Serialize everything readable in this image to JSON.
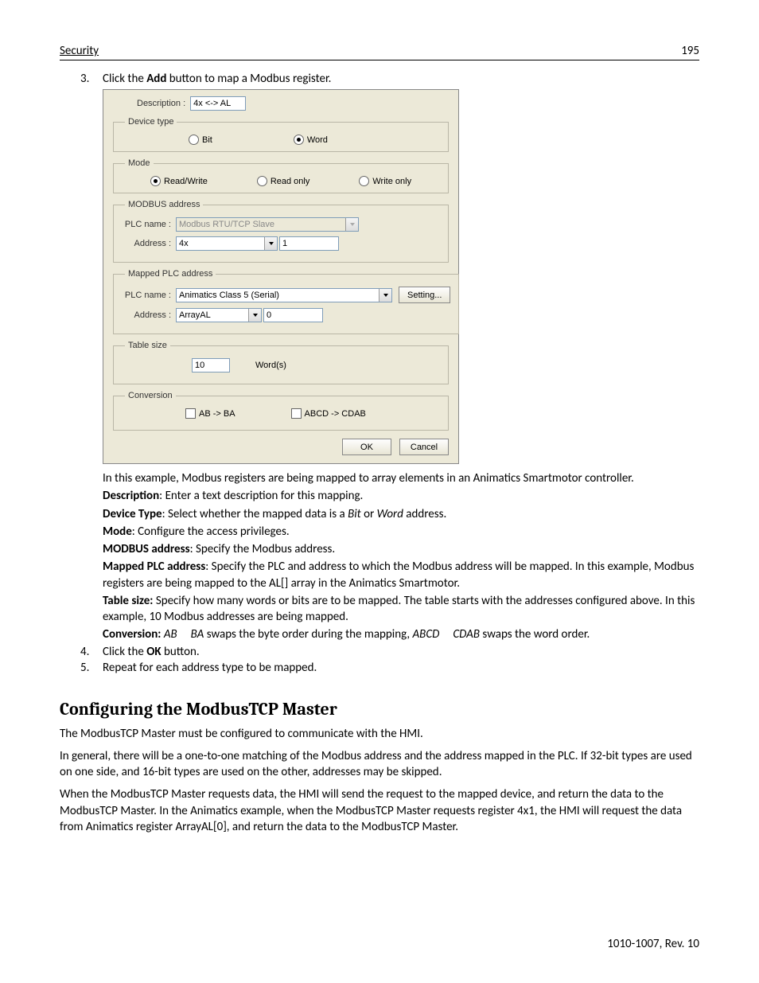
{
  "header": {
    "left": "Security",
    "right": "195"
  },
  "step3": {
    "num": "3.",
    "pre": "Click the ",
    "bold": "Add",
    "post": " button to map a Modbus register."
  },
  "dialog": {
    "descLabel": "Description :",
    "descValue": "4x <-> AL",
    "devType": {
      "legend": "Device type",
      "bit": "Bit",
      "word": "Word"
    },
    "mode": {
      "legend": "Mode",
      "rw": "Read/Write",
      "ro": "Read only",
      "wo": "Write only"
    },
    "modbus": {
      "legend": "MODBUS address",
      "plcLabel": "PLC name :",
      "plcValue": "Modbus RTU/TCP Slave",
      "addrLabel": "Address :",
      "addrType": "4x",
      "addrNum": "1"
    },
    "mapped": {
      "legend": "Mapped PLC address",
      "plcLabel": "PLC name :",
      "plcValue": "Animatics Class 5 (Serial)",
      "setting": "Setting...",
      "addrLabel": "Address :",
      "addrType": "ArrayAL",
      "addrNum": "0"
    },
    "table": {
      "legend": "Table size",
      "value": "10",
      "unit": "Word(s)"
    },
    "conv": {
      "legend": "Conversion",
      "ab": "AB -> BA",
      "abcd": "ABCD -> CDAB"
    },
    "ok": "OK",
    "cancel": "Cancel"
  },
  "explain": {
    "intro": "In this example, Modbus registers are being mapped to array elements in an Animatics Smartmotor controller.",
    "desc_b": "Description",
    "desc_t": ": Enter a text description for this mapping.",
    "dev_b": "Device Type",
    "dev_t": ": Select whether the mapped data is a ",
    "dev_i1": "Bit",
    "dev_m": " or ",
    "dev_i2": "Word",
    "dev_e": " address.",
    "mode_b": "Mode",
    "mode_t": ": Configure the access privileges.",
    "mb_b": "MODBUS address",
    "mb_t": ": Specify the Modbus address.",
    "map_b": "Mapped PLC address",
    "map_t": ": Specify the PLC and address to which the Modbus address will be mapped.  In this example, Modbus registers are being mapped to the AL[] array in the Animatics Smartmotor.",
    "ts_b": "Table size:",
    "ts_t": " Specify how many words or bits are to be mapped.  The table starts with the addresses configured above.  In this example, 10 Modbus addresses are being mapped.",
    "cv_b": "Conversion:",
    "cv_i1": " AB     BA",
    "cv_m": " swaps the byte order during the mapping, ",
    "cv_i2": "ABCD     CDAB",
    "cv_e": " swaps the word order."
  },
  "step4": {
    "num": "4.",
    "pre": "Click the ",
    "bold": "OK",
    "post": " button."
  },
  "step5": {
    "num": "5.",
    "text": "Repeat for each address type to be mapped."
  },
  "h2": "Configuring the ModbusTCP Master",
  "p1": "The ModbusTCP Master must be configured to communicate with the HMI.",
  "p2": "In general, there will be a one-to-one matching of the Modbus address and the address mapped in the PLC.  If 32-bit types are used on one side, and 16-bit types are used on the other, addresses may be skipped.",
  "p3": "When the ModbusTCP Master requests data, the HMI will send the request to the mapped device, and return the data to the ModbusTCP Master.  In the Animatics example, when the ModbusTCP Master requests register 4x1, the HMI will request the data from Animatics register ArrayAL[0], and return the data to the ModbusTCP Master.",
  "footer": "1010-1007, Rev. 10"
}
